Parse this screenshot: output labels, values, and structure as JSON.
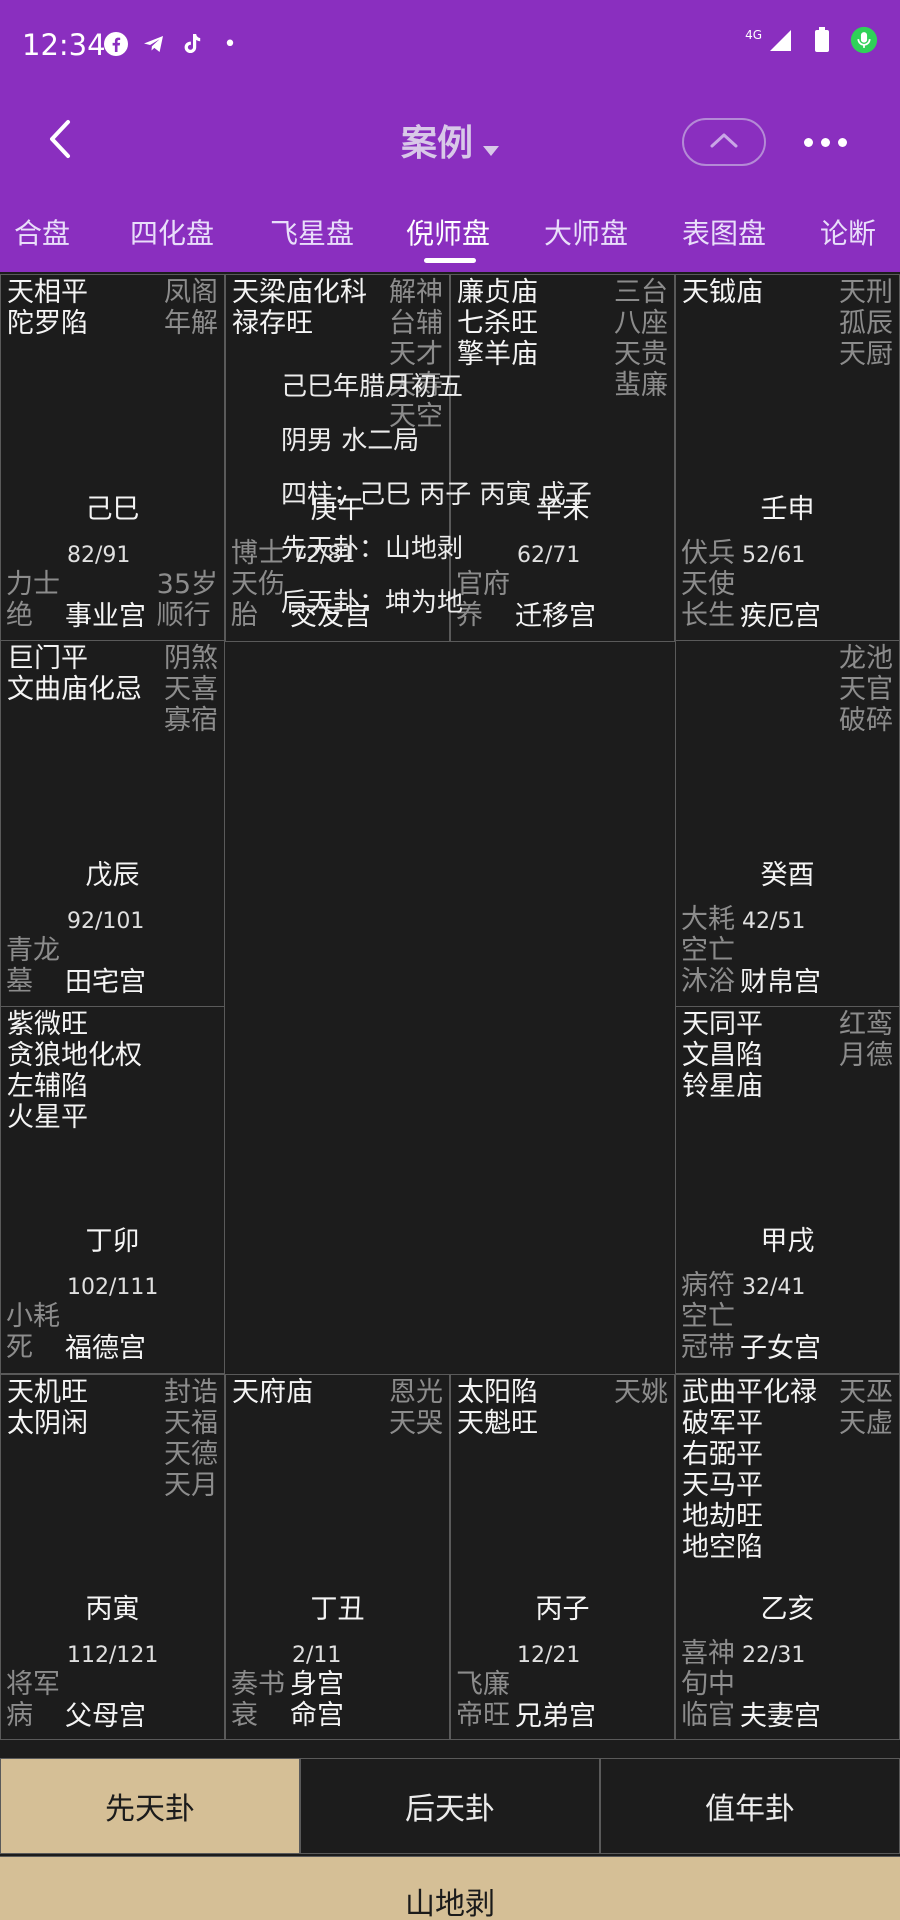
{
  "status": {
    "time": "12:34",
    "dot": "•",
    "network": "4G"
  },
  "app": {
    "title": "案例"
  },
  "tabs": [
    "合盘",
    "四化盘",
    "飞星盘",
    "倪师盘",
    "大师盘",
    "表图盘",
    "论断"
  ],
  "chart_cells": [
    {
      "stars": [
        "天相平",
        "陀罗陷"
      ],
      "minor": [
        "凤阁",
        "年解"
      ],
      "stem": "己巳",
      "age": "82/91",
      "gods": [
        "力士",
        "绝"
      ],
      "years": "35岁\n顺行",
      "palace": "事业宫"
    },
    {
      "stars": [
        "天梁庙化科",
        "禄存旺"
      ],
      "minor": [
        "解神",
        "台辅",
        "天才",
        "天寿",
        "天空"
      ],
      "stem": "庚午",
      "age": "72/81",
      "gods": [
        "博士",
        "天伤",
        "胎"
      ],
      "palace": "交友宫"
    },
    {
      "stars": [
        "廉贞庙",
        "七杀旺",
        "擎羊庙"
      ],
      "minor": [
        "三台",
        "八座",
        "天贵",
        "蜚廉"
      ],
      "stem": "辛未",
      "age": "62/71",
      "gods": [
        "官府",
        "养"
      ],
      "palace": "迁移宫"
    },
    {
      "stars": [
        "天钺庙"
      ],
      "minor": [
        "天刑",
        "孤辰",
        "天厨"
      ],
      "stem": "壬申",
      "age": "52/61",
      "gods": [
        "伏兵",
        "天使",
        "长生"
      ],
      "palace": "疾厄宫"
    },
    {
      "stars": [
        "巨门平",
        "文曲庙化忌"
      ],
      "minor": [
        "阴煞",
        "天喜",
        "寡宿"
      ],
      "stem": "戊辰",
      "age": "92/101",
      "gods": [
        "青龙",
        "墓"
      ],
      "palace": "田宅宫"
    },
    {
      "stars": [],
      "minor": [
        "龙池",
        "天官",
        "破碎"
      ],
      "stem": "癸酉",
      "age": "42/51",
      "gods": [
        "大耗",
        "空亡",
        "沐浴"
      ],
      "palace": "财帛宫"
    },
    {
      "stars": [
        "紫微旺",
        "贪狼地化权",
        "左辅陷",
        "火星平"
      ],
      "minor": [],
      "stem": "丁卯",
      "age": "102/111",
      "gods": [
        "小耗",
        "死"
      ],
      "palace": "福德宫"
    },
    {
      "stars": [
        "天同平",
        "文昌陷",
        "铃星庙"
      ],
      "minor": [
        "红鸾",
        "月德"
      ],
      "stem": "甲戌",
      "age": "32/41",
      "gods": [
        "病符",
        "空亡",
        "冠带"
      ],
      "palace": "子女宫"
    },
    {
      "stars": [
        "天机旺",
        "太阴闲"
      ],
      "minor": [
        "封诰",
        "天福",
        "天德",
        "天月"
      ],
      "stem": "丙寅",
      "age": "112/121",
      "gods": [
        "将军",
        "病"
      ],
      "palace": "父母宫"
    },
    {
      "stars": [
        "天府庙"
      ],
      "minor": [
        "恩光",
        "天哭"
      ],
      "stem": "丁丑",
      "age": "2/11",
      "gods": [
        "奏书",
        "衰"
      ],
      "palace": "身宫\n命宫"
    },
    {
      "stars": [
        "太阳陷",
        "天魁旺"
      ],
      "minor": [
        "天姚"
      ],
      "stem": "丙子",
      "age": "12/21",
      "gods": [
        "飞廉",
        "帝旺"
      ],
      "palace": "兄弟宫"
    },
    {
      "stars": [
        "武曲平化禄",
        "破军平",
        "右弼平",
        "天马平",
        "地劫旺",
        "地空陷"
      ],
      "minor": [
        "天巫",
        "天虚"
      ],
      "stem": "乙亥",
      "age": "22/31",
      "gods": [
        "喜神",
        "旬中",
        "临官"
      ],
      "palace": "夫妻宫"
    }
  ],
  "center": {
    "date": "己巳年腊月初五",
    "gender_bureau": "阴男  水二局",
    "pillars": "四柱：己巳 丙子 丙寅 戊子",
    "pre_heaven": "先天卦：山地剥",
    "post_heaven": "后天卦：坤为地"
  },
  "bottom_tabs": [
    "先天卦",
    "后天卦",
    "值年卦"
  ],
  "hexagram": "山地剥",
  "colors": {
    "purple": "#8a2fbf",
    "tan": "#d5bf96",
    "grid_bg": "#1c1c1c"
  }
}
